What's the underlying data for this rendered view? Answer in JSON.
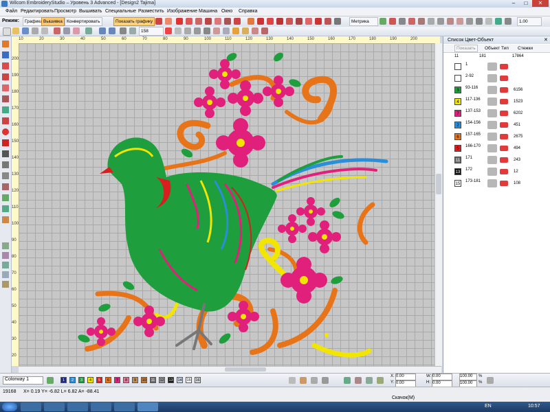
{
  "window": {
    "title": "Wilcom EmbroideryStudio – Уровень 3 Advanced - [Design2 Tajima]"
  },
  "menu": [
    "Файл",
    "Редактировать",
    "Просмотр",
    "Вышивать",
    "Специальные",
    "Разместить",
    "Изображение",
    "Машина",
    "Окно",
    "Справка"
  ],
  "toolbar": {
    "mode_label": "Режим:",
    "mode_graphics": "Графика",
    "mode_embroidery": "Вышивка",
    "convert": "Конвертировать",
    "show_graphics": "Показать графику",
    "zoom_value": "158",
    "units": "Метрика",
    "stitch_value": "1.00"
  },
  "ruler": {
    "top": [
      "10",
      "20",
      "30",
      "40",
      "50",
      "60",
      "70",
      "80",
      "90",
      "100",
      "110",
      "120",
      "130",
      "140",
      "150",
      "160",
      "170",
      "180",
      "190",
      "200"
    ],
    "left": [
      "200",
      "190",
      "180",
      "170",
      "160",
      "150",
      "140",
      "130",
      "120",
      "110",
      "100",
      "90",
      "80",
      "70",
      "60",
      "50",
      "40",
      "30",
      "20"
    ]
  },
  "panel": {
    "title": "Список Цвет-Объект",
    "show_button": "Показать",
    "col_object": "Объект",
    "col_type": "Тип",
    "col_stitches": "Стежки",
    "summary": {
      "col1": "11",
      "col2": "181",
      "stitches": "17864"
    },
    "rows": [
      {
        "num": "",
        "range": "1",
        "stitches": "",
        "color": "#ffffff"
      },
      {
        "num": "",
        "range": "2-92",
        "stitches": "",
        "color": "#ffffff"
      },
      {
        "num": "3",
        "range": "93-116",
        "stitches": "6156",
        "color": "#1e9e3c"
      },
      {
        "num": "4",
        "range": "117-136",
        "stitches": "1523",
        "color": "#f2e600"
      },
      {
        "num": "7",
        "range": "137-153",
        "stitches": "6202",
        "color": "#e0207a"
      },
      {
        "num": "2",
        "range": "154-156",
        "stitches": "451",
        "color": "#2a8ed8"
      },
      {
        "num": "6",
        "range": "157-165",
        "stitches": "2675",
        "color": "#e8741a"
      },
      {
        "num": "5",
        "range": "166-170",
        "stitches": "494",
        "color": "#d81e1e"
      },
      {
        "num": "11",
        "range": "171",
        "stitches": "243",
        "color": "#6b6b6b"
      },
      {
        "num": "13",
        "range": "172",
        "stitches": "12",
        "color": "#111111"
      },
      {
        "num": "15",
        "range": "173-181",
        "stitches": "108",
        "color": "#ffffff"
      }
    ]
  },
  "bottom": {
    "colorway": "Colorway 1",
    "swatches": [
      {
        "n": "1",
        "c": "#1a2a8a"
      },
      {
        "n": "2",
        "c": "#2a8ed8"
      },
      {
        "n": "3",
        "c": "#1e9e3c"
      },
      {
        "n": "4",
        "c": "#f2e600"
      },
      {
        "n": "5",
        "c": "#d81e1e"
      },
      {
        "n": "6",
        "c": "#e8741a"
      },
      {
        "n": "7",
        "c": "#e0207a"
      },
      {
        "n": "8",
        "c": "#e07a9a"
      },
      {
        "n": "9",
        "c": "#c09060"
      },
      {
        "n": "10",
        "c": "#c08040"
      },
      {
        "n": "11",
        "c": "#6b6b6b"
      },
      {
        "n": "12",
        "c": "#9a9a9a"
      },
      {
        "n": "13",
        "c": "#111111"
      },
      {
        "n": "14",
        "c": "#cfd7e8"
      },
      {
        "n": "15",
        "c": "#ffffff"
      },
      {
        "n": "16",
        "c": "#d8d8d8"
      }
    ],
    "x_label": "X:",
    "x_value": "0.00",
    "y_label": "Y:",
    "y_value": "0.00",
    "w_label": "W:",
    "w_value": "0.00",
    "h_label": "H:",
    "h_value": "0.00",
    "pct1": "100.00",
    "pct2": "100.00",
    "pct_sign": "%"
  },
  "status": {
    "stitch_count": "19168",
    "coords": "X= 0.19 Y= -6.82 L= 6.82 A= -88.41",
    "center": "Скачок(M)"
  },
  "taskbar": {
    "lang": "EN",
    "time": "10:57"
  },
  "colors": {
    "fabric": "#c7c7c7",
    "green": "#1e9e3c",
    "magenta": "#e0207a",
    "orange": "#e8741a",
    "yellow": "#f2e600",
    "blue": "#2a8ed8"
  }
}
